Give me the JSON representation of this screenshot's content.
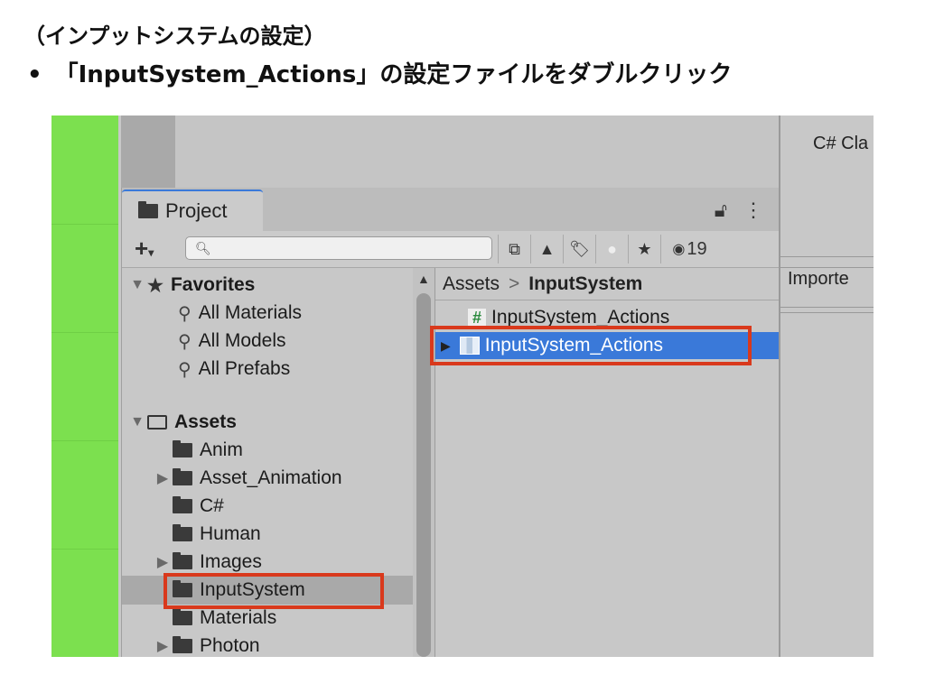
{
  "slide": {
    "heading": "（インプットシステムの設定）",
    "bullet_mark": "•",
    "bullet_text": "「InputSystem_Actions」の設定ファイルをダブルクリック"
  },
  "project_window": {
    "tab_label": "Project",
    "lock_icon": "lock-icon",
    "menu_icon": "more-vertical-icon",
    "toolbar": {
      "add_label": "+",
      "search_placeholder": "",
      "visible_count": "19"
    },
    "favorites": {
      "label": "Favorites",
      "items": [
        "All Materials",
        "All Models",
        "All Prefabs"
      ]
    },
    "assets": {
      "label": "Assets",
      "folders": [
        {
          "name": "Anim",
          "expandable": false
        },
        {
          "name": "Asset_Animation",
          "expandable": true
        },
        {
          "name": "C#",
          "expandable": false
        },
        {
          "name": "Human",
          "expandable": false
        },
        {
          "name": "Images",
          "expandable": true
        },
        {
          "name": "InputSystem",
          "expandable": false,
          "selected": true
        },
        {
          "name": "Materials",
          "expandable": false
        },
        {
          "name": "Photon",
          "expandable": true
        }
      ]
    },
    "breadcrumb": {
      "root": "Assets",
      "separator": ">",
      "current": "InputSystem"
    },
    "files": [
      {
        "name": "InputSystem_Actions",
        "icon": "csharp-script-icon",
        "selected": false
      },
      {
        "name": "InputSystem_Actions",
        "icon": "input-actions-icon",
        "selected": true
      }
    ]
  },
  "inspector": {
    "top_text": "C# Cla",
    "mid_text": "Importe"
  },
  "colors": {
    "accent_blue": "#3a79d9",
    "highlight_red": "#d9391c",
    "scene_green": "#7ce04f"
  }
}
